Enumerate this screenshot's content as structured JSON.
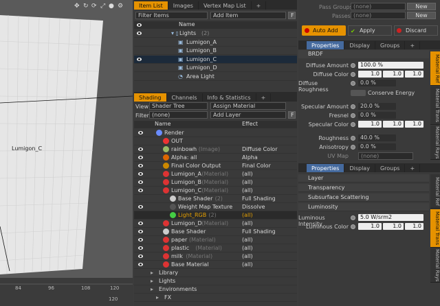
{
  "viewport": {
    "label": "Lumigon_C",
    "ruler": [
      "84",
      "96",
      "108",
      "120"
    ],
    "ruler_bottom": "120",
    "icons": [
      "move-icon",
      "rotate-icon",
      "refresh-icon",
      "zoom-icon",
      "sphere-icon",
      "gear-icon"
    ]
  },
  "top_tabs": {
    "items": [
      "Item List",
      "Images",
      "Vertex Map List"
    ],
    "add": "+"
  },
  "item_list": {
    "filter": "Filter Items",
    "add_item": "Add Item",
    "f": "F",
    "col_name": "Name",
    "rows": [
      {
        "name": "Lights",
        "suffix": "(2)"
      },
      {
        "name": "Lumigon_A",
        "suffix": ""
      },
      {
        "name": "Lumigon_B",
        "suffix": ""
      },
      {
        "name": "Lumigon_C",
        "suffix": ""
      },
      {
        "name": "Lumigon_D",
        "suffix": ""
      },
      {
        "name": "Area Light",
        "suffix": ""
      }
    ]
  },
  "shading_tabs": {
    "items": [
      "Shading",
      "Channels",
      "Info & Statistics"
    ],
    "add": "+"
  },
  "shader": {
    "view_label": "View",
    "view": "Shader Tree",
    "assign": "Assign Material",
    "filter_label": "Filter",
    "filter": "(none)",
    "add_layer": "Add Layer",
    "f": "F",
    "col_name": "Name",
    "col_effect": "Effect",
    "rows": [
      {
        "name": "Render",
        "suffix": "",
        "effect": ""
      },
      {
        "name": "OUT",
        "suffix": "",
        "effect": ""
      },
      {
        "name": "rainbowh",
        "suffix": "(Image)",
        "effect": "Diffuse Color"
      },
      {
        "name": "Alpha: all",
        "suffix": "",
        "effect": "Alpha"
      },
      {
        "name": "Final Color Output",
        "suffix": "",
        "effect": "Final Color"
      },
      {
        "name": "Lumigon_A",
        "suffix": "(Material)",
        "effect": "(all)"
      },
      {
        "name": "Lumigon_B",
        "suffix": "(Material)",
        "effect": "(all)"
      },
      {
        "name": "Lumigon_C",
        "suffix": "(Material)",
        "effect": "(all)"
      },
      {
        "name": "Base Shader",
        "suffix": "(2)",
        "effect": "Full Shading"
      },
      {
        "name": "Weight Map Texture",
        "suffix": "",
        "effect": "Dissolve"
      },
      {
        "name": "Light_RGB",
        "suffix": "(2)",
        "effect": "(all)"
      },
      {
        "name": "Lumigon_D",
        "suffix": "(Material)",
        "effect": "(all)"
      },
      {
        "name": "Base Shader",
        "suffix": "",
        "effect": "Full Shading"
      },
      {
        "name": "paper",
        "suffix": "(Material)",
        "effect": "(all)"
      },
      {
        "name": "plastic",
        "suffix": "(Material)",
        "effect": "(all)"
      },
      {
        "name": "milk",
        "suffix": "(Material)",
        "effect": "(all)"
      },
      {
        "name": "Base Material",
        "suffix": "",
        "effect": "(all)"
      },
      {
        "name": "Library",
        "suffix": "",
        "effect": ""
      },
      {
        "name": "Lights",
        "suffix": "",
        "effect": ""
      },
      {
        "name": "Environments",
        "suffix": "",
        "effect": ""
      },
      {
        "name": "FX",
        "suffix": "",
        "effect": ""
      }
    ]
  },
  "pass": {
    "groups_label": "Pass Groups",
    "groups_value": "(none)",
    "new1": "New",
    "passes_label": "Passes",
    "passes_value": "(none)",
    "new2": "New"
  },
  "actions": {
    "auto_add": "Auto Add",
    "apply": "Apply",
    "discard": "Discard"
  },
  "props1": {
    "tabs": [
      "Properties",
      "Display",
      "Groups"
    ],
    "add": "+",
    "section": "BRDF",
    "diffuse_amount": {
      "label": "Diffuse Amount",
      "value": "100.0 %"
    },
    "diffuse_color": {
      "label": "Diffuse Color",
      "r": "1.0",
      "g": "1.0",
      "b": "1.0"
    },
    "diffuse_rough": {
      "label": "Diffuse Roughness",
      "value": "0.0 %"
    },
    "conserve": "Conserve Energy",
    "spec_amount": {
      "label": "Specular Amount",
      "value": "20.0 %"
    },
    "fresnel": {
      "label": "Fresnel",
      "value": "0.0 %"
    },
    "spec_color": {
      "label": "Specular Color",
      "r": "1.0",
      "g": "1.0",
      "b": "1.0"
    },
    "roughness": {
      "label": "Roughness",
      "value": "40.0 %"
    },
    "anisotropy": {
      "label": "Anisotropy",
      "value": "0.0 %"
    },
    "uvmap": {
      "label": "UV Map",
      "value": "(none)"
    },
    "vtabs": [
      "Material Ref",
      "Material Trans",
      "Material Rays"
    ]
  },
  "props2": {
    "tabs": [
      "Properties",
      "Display",
      "Groups"
    ],
    "add": "+",
    "sections": [
      "Layer",
      "Transparency",
      "Subsurface Scattering",
      "Luminosity"
    ],
    "lum_intensity": {
      "label": "Luminous Intensity",
      "value": "5.0 W/srm2"
    },
    "lum_color": {
      "label": "Luminous Color",
      "r": "1.0",
      "g": "1.0",
      "b": "1.0"
    },
    "vtabs": [
      "Material Ref",
      "Material Trans",
      "Material Rays"
    ]
  },
  "colors": {
    "accent": "#e69200",
    "selected_row": "#1c2a3a",
    "lightrgb": "#e6a000"
  }
}
